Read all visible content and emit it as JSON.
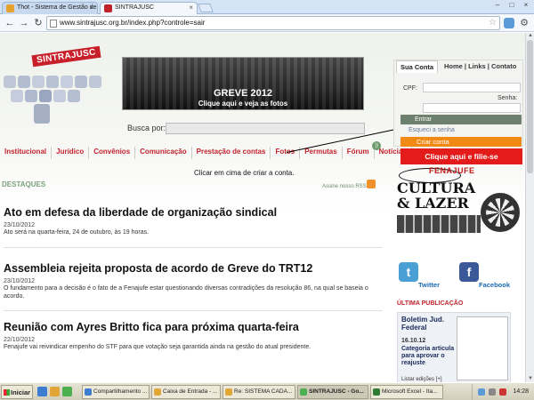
{
  "browser": {
    "tabs": [
      {
        "title": "Thot - Sistema de Gestão de",
        "active": false
      },
      {
        "title": "SINTRAJUSC",
        "active": true
      }
    ],
    "url": "www.sintrajusc.org.br/index.php?controle=sair"
  },
  "site": {
    "logo_text": "SINTRAJUSC",
    "banner_line1": "GREVE 2012",
    "banner_line2": "Clique aqui e veja as fotos",
    "search_label": "Busca por:",
    "nav": [
      "Institucional",
      "Jurídico",
      "Convênios",
      "Comunicação",
      "Prestação de contas",
      "Fotos",
      "Permutas",
      "Fórum",
      "Notícias"
    ],
    "annotation": "Clicar em cima de criar a conta.",
    "destaques": "DESTAQUES",
    "rss_label": "Assine nosso RSS",
    "articles": [
      {
        "title": "Ato em defesa da liberdade de organização sindical",
        "date": "23/10/2012",
        "desc": "Ato será na quarta-feira, 24 de outubro, às 19 horas."
      },
      {
        "title": "Assembleia rejeita proposta de acordo de Greve do TRT12",
        "date": "23/10/2012",
        "desc": "O fundamento para a decisão é o fato de a Fenajufe estar questionando diversas contradições da resolução 86, na qual se baseia o acordo."
      },
      {
        "title": "Reunião com Ayres Britto fica para próxima quarta-feira",
        "date": "22/10/2012",
        "desc": "Fenajufe vai reivindicar empenho do STF para que votação seja garantida ainda na gestão do atual presidente."
      }
    ],
    "login": {
      "tab_active": "Sua Conta",
      "tab_links": "Home | Links | Contato",
      "cpf_label": "CPF:",
      "senha_label": "Senha:",
      "entrar": "Entrar",
      "esqueci": "Esqueci a senha",
      "criar": "Criar conta"
    },
    "filie": "Clique aqui e filie-se",
    "fenajufe": "FENAJUFE",
    "cultura": "CULTURA",
    "lazer": "& LAZER",
    "twitter": "Twitter",
    "facebook": "Facebook",
    "ultima": "ÚLTIMA PUBLICAÇÃO",
    "boletim_title": "Boletim Jud. Federal",
    "boletim_date": "16.10.12",
    "boletim_subject": "Categoria articula para aprovar o reajuste",
    "boletim_list": "Listar edições [+]"
  },
  "taskbar": {
    "start": "Iniciar",
    "tasks": [
      {
        "label": "Compartilhamento ...",
        "active": false
      },
      {
        "label": "Caixa de Entrada - ...",
        "active": false
      },
      {
        "label": "Re: SISTEMA CADA...",
        "active": false
      },
      {
        "label": "SINTRAJUSC - Go...",
        "active": true
      },
      {
        "label": "Microsoft Excel - Ita...",
        "active": false
      }
    ],
    "clock": "14:28"
  },
  "colors": {
    "brand_red": "#c0222a",
    "orange": "#f18a14",
    "filie_red": "#e31b1b"
  }
}
